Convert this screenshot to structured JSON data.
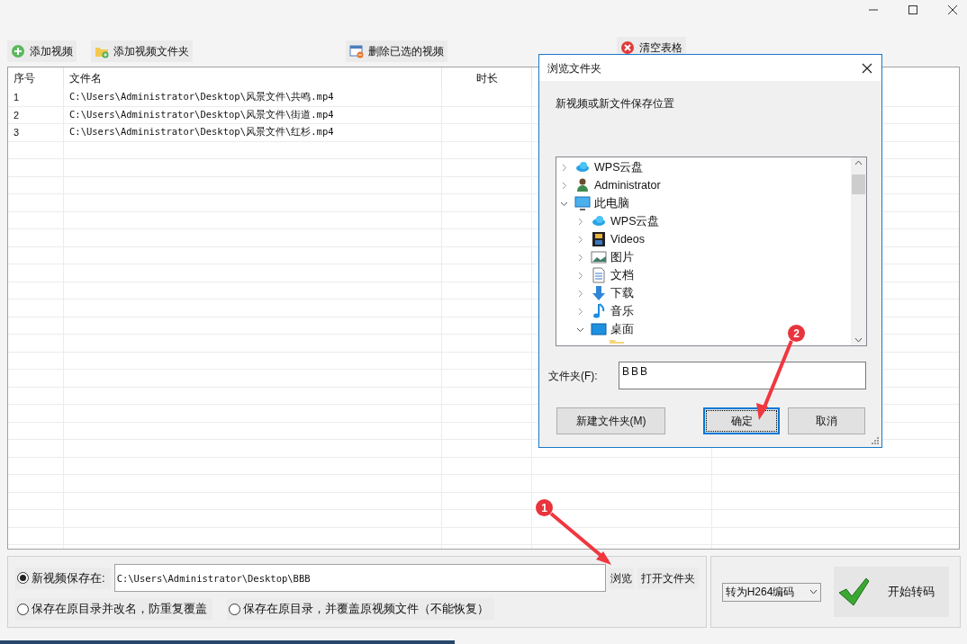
{
  "toolbar": [
    {
      "label": "添加视频",
      "kind": "add"
    },
    {
      "label": "添加视频文件夹",
      "kind": "folder-add"
    },
    {
      "label": "删除已选的视频",
      "kind": "delete"
    },
    {
      "label": "清空表格",
      "kind": "clear"
    }
  ],
  "table": {
    "columns": [
      "序号",
      "文件名",
      "时长"
    ],
    "rows": [
      [
        "1",
        "C:\\Users\\Administrator\\Desktop\\风景文件\\共鸣.mp4"
      ],
      [
        "2",
        "C:\\Users\\Administrator\\Desktop\\风景文件\\街道.mp4"
      ],
      [
        "3",
        "C:\\Users\\Administrator\\Desktop\\风景文件\\红杉.mp4"
      ]
    ]
  },
  "save_options": [
    {
      "label": "新视频保存在:",
      "selected": true
    },
    {
      "label": "保存在原目录并改名，防重复覆盖",
      "selected": false
    },
    {
      "label": "保存在原目录，并覆盖原视频文件（不能恢复）",
      "selected": false
    }
  ],
  "save_path": "C:\\Users\\Administrator\\Desktop\\BBB",
  "browse_button": "浏览",
  "open_folder_button": "打开文件夹",
  "format_select": "转为H264编码",
  "start_button": "开始转码",
  "dialog": {
    "title": "浏览文件夹",
    "prompt": "新视频或新文件保存位置",
    "tree": [
      {
        "label": "WPS云盘",
        "kind": "cloud",
        "expanded": false
      },
      {
        "label": "Administrator",
        "kind": "user",
        "expanded": false
      },
      {
        "label": "此电脑",
        "kind": "computer",
        "expanded": true,
        "children": [
          {
            "label": "WPS云盘",
            "kind": "cloud",
            "expanded": false
          },
          {
            "label": "Videos",
            "kind": "video",
            "expanded": false
          },
          {
            "label": "图片",
            "kind": "picture",
            "expanded": false
          },
          {
            "label": "文档",
            "kind": "document",
            "expanded": false
          },
          {
            "label": "下载",
            "kind": "download",
            "expanded": false
          },
          {
            "label": "音乐",
            "kind": "music",
            "expanded": false
          },
          {
            "label": "桌面",
            "kind": "desktop",
            "expanded": true
          }
        ]
      }
    ],
    "folder_label": "文件夹(F):",
    "folder_value": "BBB",
    "buttons": [
      {
        "label": "新建文件夹(M)",
        "focused": false
      },
      {
        "label": "确定",
        "focused": true
      },
      {
        "label": "取消",
        "focused": false
      }
    ]
  },
  "annotations": [
    "1",
    "2"
  ]
}
